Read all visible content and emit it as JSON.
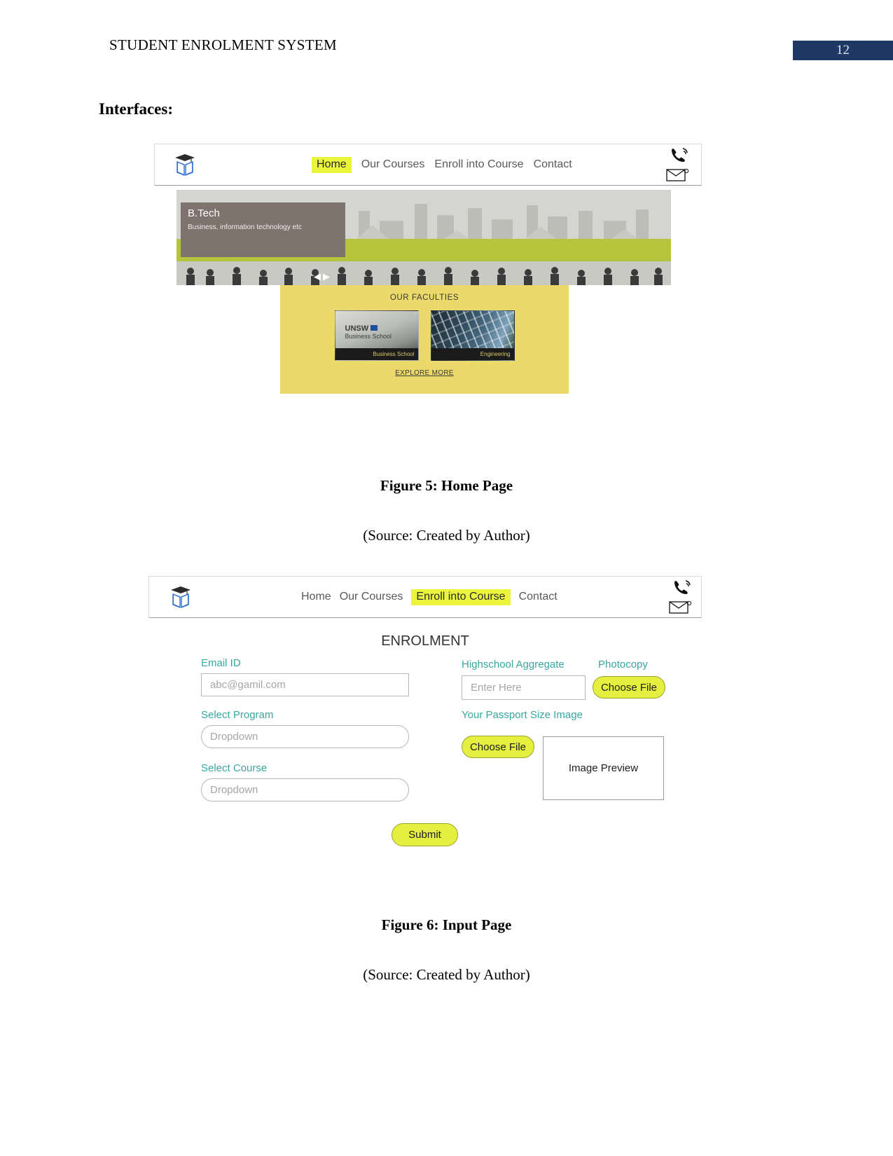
{
  "document": {
    "header_title": "STUDENT ENROLMENT SYSTEM",
    "page_number": "12",
    "page_badge_color": "#1f3864",
    "section_heading": "Interfaces:"
  },
  "figure5": {
    "caption": "Figure 5: Home Page",
    "source": "(Source: Created by Author)",
    "nav": {
      "logo_icon": "graduation-cap-book-logo",
      "links": [
        {
          "label": "Home",
          "active": true
        },
        {
          "label": "Our Courses",
          "active": false
        },
        {
          "label": "Enroll into Course",
          "active": false
        },
        {
          "label": "Contact",
          "active": false
        }
      ],
      "phone_icon": "phone-ringing-icon",
      "mail_icon": "envelope-icon",
      "active_highlight_color": "#eaf53c"
    },
    "hero": {
      "title": "B.Tech",
      "subtitle": "Business, information technology etc",
      "prev_arrow": "◀",
      "next_arrow": "▶",
      "overlay_color": "#7f736d"
    },
    "faculties": {
      "heading": "OUR FACULTIES",
      "panel_color": "#ecd96b",
      "cards": [
        {
          "caption": "Business School",
          "image": "unsw-business-school-building",
          "logo_text": "UNSW",
          "logo_sub": "Business School"
        },
        {
          "caption": "Engineering",
          "image": "solar-panel-array"
        }
      ],
      "explore_link": "EXPLORE MORE"
    }
  },
  "figure6": {
    "caption": "Figure 6: Input Page",
    "source": "(Source: Created by Author)",
    "nav": {
      "logo_icon": "graduation-cap-book-logo",
      "links": [
        {
          "label": "Home",
          "active": false
        },
        {
          "label": "Our Courses",
          "active": false
        },
        {
          "label": "Enroll into Course",
          "active": true
        },
        {
          "label": "Contact",
          "active": false
        }
      ],
      "phone_icon": "phone-ringing-icon",
      "mail_icon": "envelope-icon"
    },
    "form": {
      "title": "ENROLMENT",
      "label_color": "#3aa6a0",
      "button_color": "#e4ef3f",
      "email_label": "Email ID",
      "email_placeholder": "abc@gamil.com",
      "program_label": "Select Program",
      "program_placeholder": "Dropdown",
      "course_label": "Select Course",
      "course_placeholder": "Dropdown",
      "aggregate_label": "Highschool Aggregate",
      "aggregate_placeholder": "Enter Here",
      "photocopy_label": "Photocopy",
      "photocopy_button": "Choose File",
      "passport_label": "Your Passport Size Image",
      "passport_button": "Choose File",
      "image_preview_text": "Image Preview",
      "submit_button": "Submit"
    }
  }
}
